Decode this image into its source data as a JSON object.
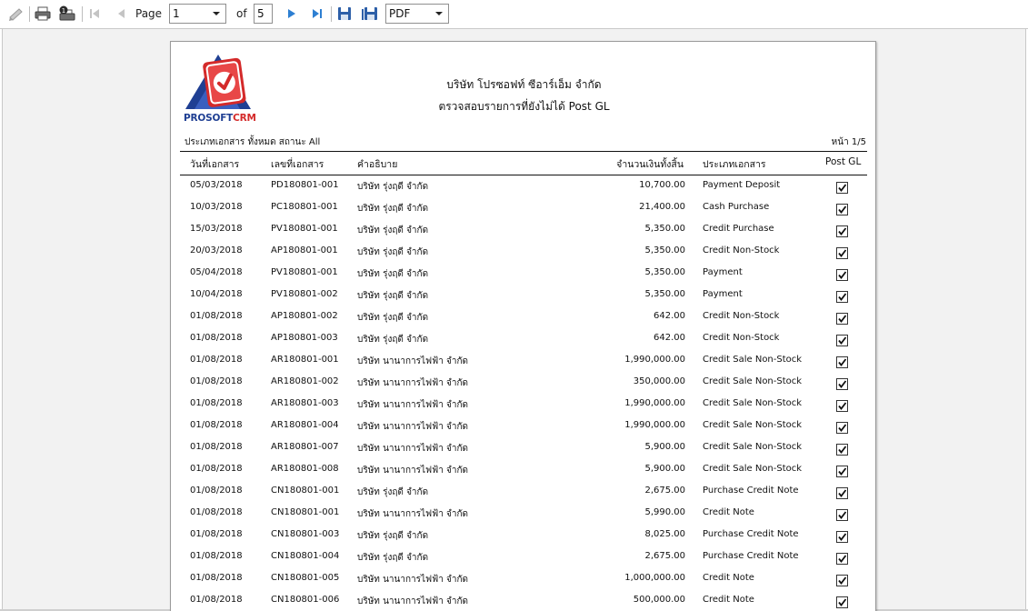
{
  "toolbar": {
    "page_label": "Page",
    "page_value": "1",
    "of_label": "of",
    "total_pages": "5",
    "export_format": "PDF",
    "icons": [
      "pencil-icon",
      "print-icon",
      "print-setup-icon",
      "first-page-icon",
      "previous-page-icon",
      "next-page-icon",
      "last-page-icon",
      "save-icon",
      "save-as-icon"
    ]
  },
  "report": {
    "logo": {
      "text_a": "PROSOFT",
      "text_b": "CRM",
      "colors": {
        "blue": "#1f3f93",
        "red": "#d42a2a"
      }
    },
    "company_name": "บริษัท โปรซอฟท์ ซีอาร์เอ็ม จำกัด",
    "title": "ตรวจสอบรายการที่ยังไม่ได้ Post GL",
    "filter_text": "ประเภทเอกสาร ทั้งหมด สถานะ All",
    "page_indicator": "หน้า 1/5",
    "columns": {
      "date": "วันที่เอกสาร",
      "doc_no": "เลขที่เอกสาร",
      "description": "คำอธิบาย",
      "amount": "จำนวนเงินทั้งสิ้น",
      "doc_type": "ประเภทเอกสาร",
      "post_gl": "Post GL"
    },
    "rows": [
      {
        "date": "05/03/2018",
        "doc_no": "PD180801-001",
        "description": "บริษัท รุ่งฤดี จำกัด",
        "amount": "10,700.00",
        "doc_type": "Payment Deposit",
        "post_gl": true
      },
      {
        "date": "10/03/2018",
        "doc_no": "PC180801-001",
        "description": "บริษัท รุ่งฤดี จำกัด",
        "amount": "21,400.00",
        "doc_type": "Cash Purchase",
        "post_gl": true
      },
      {
        "date": "15/03/2018",
        "doc_no": "PV180801-001",
        "description": "บริษัท รุ่งฤดี จำกัด",
        "amount": "5,350.00",
        "doc_type": "Credit Purchase",
        "post_gl": true
      },
      {
        "date": "20/03/2018",
        "doc_no": "AP180801-001",
        "description": "บริษัท รุ่งฤดี จำกัด",
        "amount": "5,350.00",
        "doc_type": "Credit Non-Stock",
        "post_gl": true
      },
      {
        "date": "05/04/2018",
        "doc_no": "PV180801-001",
        "description": "บริษัท รุ่งฤดี จำกัด",
        "amount": "5,350.00",
        "doc_type": "Payment",
        "post_gl": true
      },
      {
        "date": "10/04/2018",
        "doc_no": "PV180801-002",
        "description": "บริษัท รุ่งฤดี จำกัด",
        "amount": "5,350.00",
        "doc_type": "Payment",
        "post_gl": true
      },
      {
        "date": "01/08/2018",
        "doc_no": "AP180801-002",
        "description": "บริษัท รุ่งฤดี จำกัด",
        "amount": "642.00",
        "doc_type": "Credit Non-Stock",
        "post_gl": true
      },
      {
        "date": "01/08/2018",
        "doc_no": "AP180801-003",
        "description": "บริษัท รุ่งฤดี จำกัด",
        "amount": "642.00",
        "doc_type": "Credit Non-Stock",
        "post_gl": true
      },
      {
        "date": "01/08/2018",
        "doc_no": "AR180801-001",
        "description": "บริษัท นานาการไฟฟ้า จำกัด",
        "amount": "1,990,000.00",
        "doc_type": "Credit Sale Non-Stock",
        "post_gl": true
      },
      {
        "date": "01/08/2018",
        "doc_no": "AR180801-002",
        "description": "บริษัท นานาการไฟฟ้า จำกัด",
        "amount": "350,000.00",
        "doc_type": "Credit Sale Non-Stock",
        "post_gl": true
      },
      {
        "date": "01/08/2018",
        "doc_no": "AR180801-003",
        "description": "บริษัท นานาการไฟฟ้า จำกัด",
        "amount": "1,990,000.00",
        "doc_type": "Credit Sale Non-Stock",
        "post_gl": true
      },
      {
        "date": "01/08/2018",
        "doc_no": "AR180801-004",
        "description": "บริษัท นานาการไฟฟ้า จำกัด",
        "amount": "1,990,000.00",
        "doc_type": "Credit Sale Non-Stock",
        "post_gl": true
      },
      {
        "date": "01/08/2018",
        "doc_no": "AR180801-007",
        "description": "บริษัท นานาการไฟฟ้า จำกัด",
        "amount": "5,900.00",
        "doc_type": "Credit Sale Non-Stock",
        "post_gl": true
      },
      {
        "date": "01/08/2018",
        "doc_no": "AR180801-008",
        "description": "บริษัท นานาการไฟฟ้า จำกัด",
        "amount": "5,900.00",
        "doc_type": "Credit Sale Non-Stock",
        "post_gl": true
      },
      {
        "date": "01/08/2018",
        "doc_no": "CN180801-001",
        "description": "บริษัท รุ่งฤดี จำกัด",
        "amount": "2,675.00",
        "doc_type": "Purchase Credit Note",
        "post_gl": true
      },
      {
        "date": "01/08/2018",
        "doc_no": "CN180801-001",
        "description": "บริษัท นานาการไฟฟ้า จำกัด",
        "amount": "5,990.00",
        "doc_type": "Credit Note",
        "post_gl": true
      },
      {
        "date": "01/08/2018",
        "doc_no": "CN180801-003",
        "description": "บริษัท รุ่งฤดี จำกัด",
        "amount": "8,025.00",
        "doc_type": "Purchase Credit Note",
        "post_gl": true
      },
      {
        "date": "01/08/2018",
        "doc_no": "CN180801-004",
        "description": "บริษัท รุ่งฤดี จำกัด",
        "amount": "2,675.00",
        "doc_type": "Purchase Credit Note",
        "post_gl": true
      },
      {
        "date": "01/08/2018",
        "doc_no": "CN180801-005",
        "description": "บริษัท นานาการไฟฟ้า จำกัด",
        "amount": "1,000,000.00",
        "doc_type": "Credit Note",
        "post_gl": true
      },
      {
        "date": "01/08/2018",
        "doc_no": "CN180801-006",
        "description": "บริษัท นานาการไฟฟ้า จำกัด",
        "amount": "500,000.00",
        "doc_type": "Credit Note",
        "post_gl": true
      }
    ]
  }
}
